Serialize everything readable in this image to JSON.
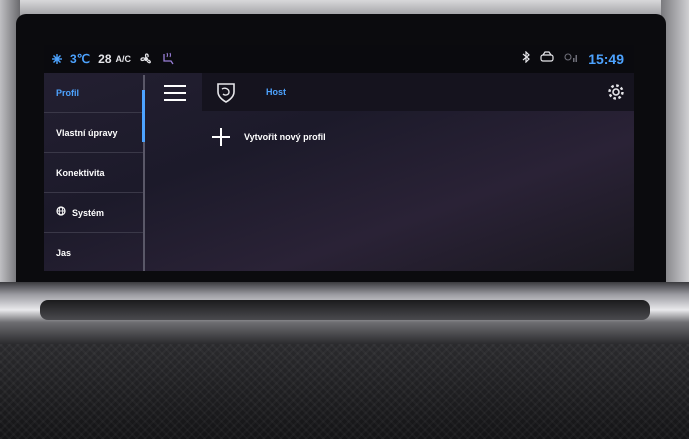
{
  "status": {
    "temp_unit": "3℃",
    "fan": "28",
    "ac": "A/C",
    "time": "15:49"
  },
  "sidebar": {
    "items": [
      {
        "label": "Profil"
      },
      {
        "label": "Vlastní úpravy"
      },
      {
        "label": "Konektivita"
      },
      {
        "label": "Systém"
      },
      {
        "label": "Jas"
      }
    ]
  },
  "header": {
    "profile_name": "Host"
  },
  "main": {
    "add_profile_label": "Vytvořit nový profil"
  },
  "colors": {
    "accent": "#4da3ff",
    "background": "#1c1a2a"
  },
  "icons": [
    "snowflake-icon",
    "fan-icon",
    "seat-heat-icon",
    "bluetooth-icon",
    "car-icon",
    "signal-icon",
    "menu-icon",
    "brand-logo-icon",
    "gear-icon",
    "plus-icon",
    "globe-icon"
  ]
}
